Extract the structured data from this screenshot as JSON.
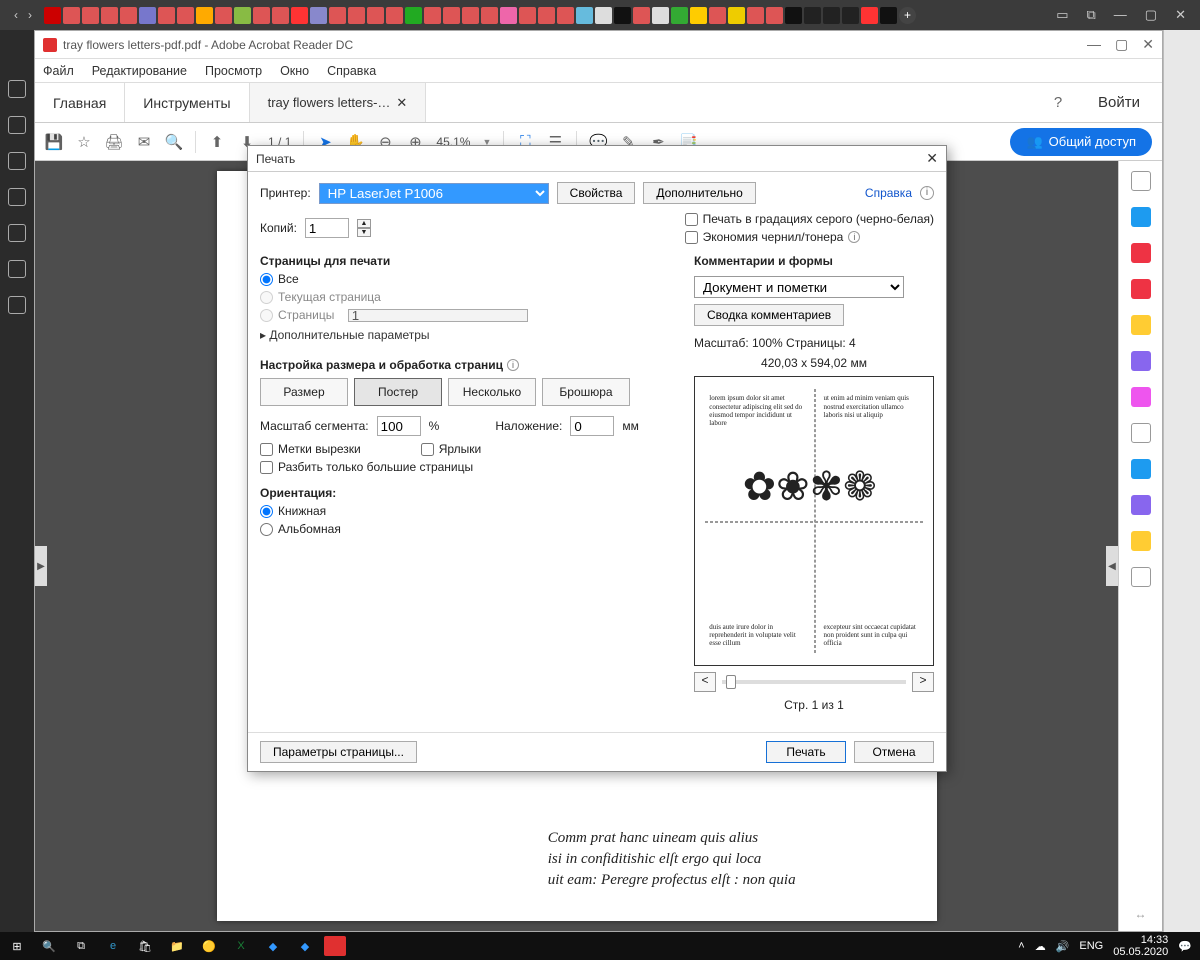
{
  "acrobat": {
    "title": "tray flowers letters-pdf.pdf - Adobe Acrobat Reader DC",
    "menu": [
      "Файл",
      "Редактирование",
      "Просмотр",
      "Окно",
      "Справка"
    ],
    "tabs": {
      "home": "Главная",
      "tools": "Инструменты",
      "doc": "tray flowers letters-…"
    },
    "signin": "Войти",
    "toolbar": {
      "page_cur": "1",
      "page_sep": "/",
      "page_total": "1",
      "zoom": "45,1%"
    },
    "share": "Общий доступ"
  },
  "dlg": {
    "title": "Печать",
    "printer_lbl": "Принтер:",
    "printer_val": "HP LaserJet P1006",
    "props": "Свойства",
    "advanced": "Дополнительно",
    "help": "Справка",
    "copies_lbl": "Копий:",
    "copies_val": "1",
    "grayscale": "Печать в градациях серого (черно-белая)",
    "inksave": "Экономия чернил/тонера",
    "pages_sect": "Страницы для печати",
    "all": "Все",
    "current": "Текущая страница",
    "pages_lbl": "Страницы",
    "pages_val": "1",
    "more": "Дополнительные параметры",
    "size_sect": "Настройка размера и обработка страниц",
    "size": "Размер",
    "poster": "Постер",
    "multi": "Несколько",
    "booklet": "Брошюра",
    "seg_lbl": "Масштаб сегмента:",
    "seg_val": "100",
    "seg_unit": "%",
    "ovl_lbl": "Наложение:",
    "ovl_val": "0",
    "ovl_unit": "мм",
    "cut": "Метки вырезки",
    "labels": "Ярлыки",
    "bigonly": "Разбить только большие страницы",
    "orient": "Ориентация:",
    "portrait": "Книжная",
    "landscape": "Альбомная",
    "comm_sect": "Комментарии и формы",
    "comm_sel": "Документ и пометки",
    "comm_sum": "Сводка комментариев",
    "scaleinfo": "Масштаб: 100% Страницы: 4",
    "dims": "420,03 x 594,02 мм",
    "page_of": "Стр. 1 из 1",
    "pagesetup": "Параметры страницы...",
    "print": "Печать",
    "cancel": "Отмена"
  },
  "taskbar": {
    "lang": "ENG",
    "time": "14:33",
    "date": "05.05.2020"
  }
}
